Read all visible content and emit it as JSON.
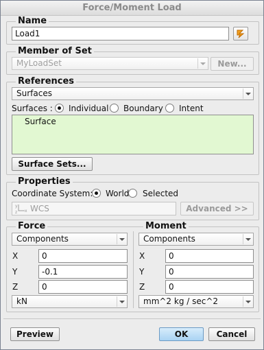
{
  "window": {
    "title": "Force/Moment Load"
  },
  "name_group": {
    "title": "Name",
    "value": "Load1"
  },
  "member_group": {
    "title": "Member of Set",
    "value": "MyLoadSet",
    "new_label": "New..."
  },
  "references": {
    "title": "References",
    "type_value": "Surfaces",
    "surfaces_label": "Surfaces :",
    "options": [
      "Individual",
      "Boundary",
      "Intent"
    ],
    "selected_option": "Individual",
    "list_items": [
      "Surface"
    ],
    "surface_sets_label": "Surface Sets..."
  },
  "properties": {
    "title": "Properties",
    "coord_label": "Coordinate System:",
    "coord_options": [
      "World",
      "Selected"
    ],
    "selected_coord": "World",
    "coord_value": "WCS",
    "advanced_label": "Advanced >>"
  },
  "force": {
    "title": "Force",
    "type_value": "Components",
    "x_label": "X",
    "x_value": "0",
    "y_label": "Y",
    "y_value": "-0.1",
    "z_label": "Z",
    "z_value": "0",
    "units": "kN"
  },
  "moment": {
    "title": "Moment",
    "type_value": "Components",
    "x_label": "X",
    "x_value": "0",
    "y_label": "Y",
    "y_value": "0",
    "z_label": "Z",
    "z_value": "0",
    "units": "mm^2 kg / sec^2"
  },
  "footer": {
    "preview_label": "Preview",
    "ok_label": "OK",
    "cancel_label": "Cancel"
  },
  "icons": {
    "select_arrow": "select-arrow-icon",
    "coord_axes": "coordinate-axes-icon"
  }
}
